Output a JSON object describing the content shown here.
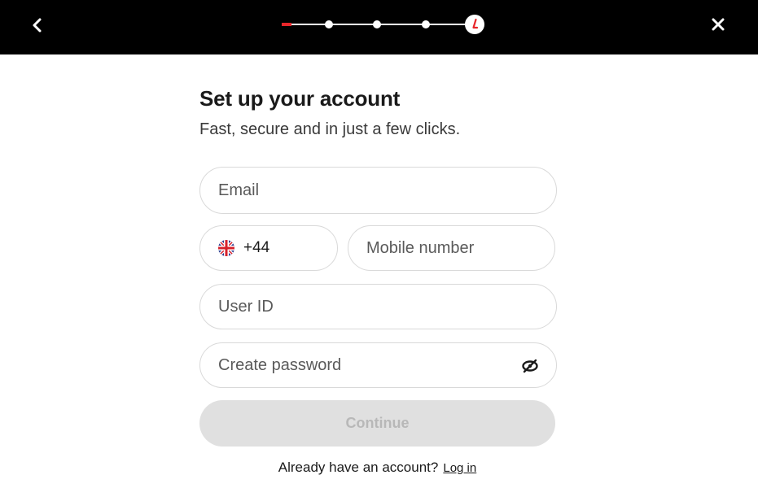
{
  "header": {
    "back_icon": "chevron-left-icon",
    "close_icon": "close-icon",
    "progress": {
      "steps": 5,
      "current_step": 1,
      "accent_color": "#e8262a",
      "end_icon": "brand-l-icon"
    }
  },
  "form": {
    "title": "Set up your account",
    "subtitle": "Fast, secure and in just a few clicks.",
    "email_placeholder": "Email",
    "country_code": "+44",
    "country_flag_icon": "uk-flag-icon",
    "mobile_placeholder": "Mobile number",
    "user_id_placeholder": "User ID",
    "password_placeholder": "Create password",
    "password_toggle_icon": "eye-off-icon",
    "continue_label": "Continue"
  },
  "footer": {
    "prompt": "Already have an account?",
    "login_label": "Log in"
  }
}
